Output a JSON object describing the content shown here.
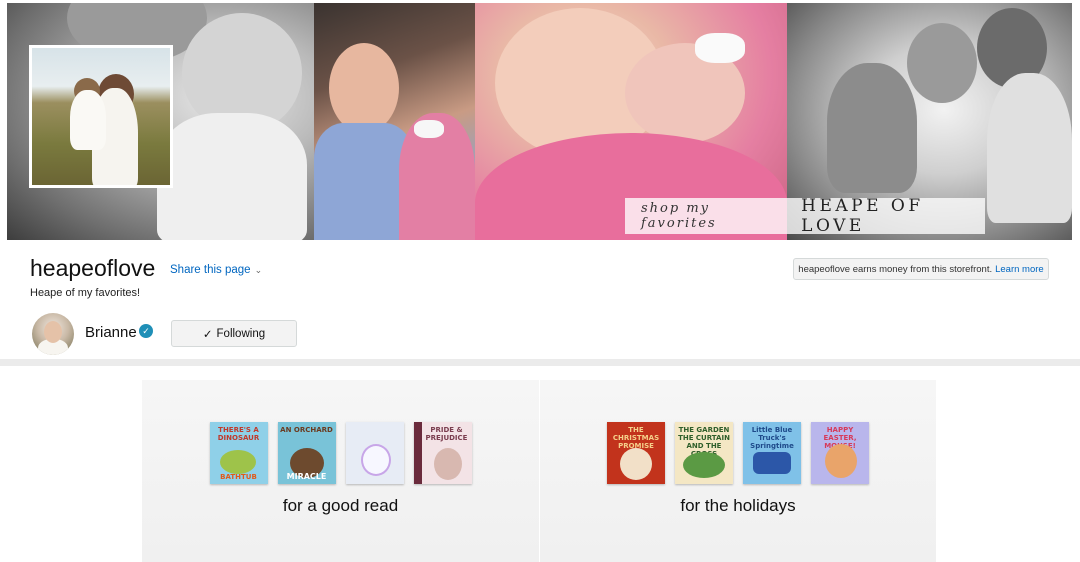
{
  "banner": {
    "tagline_small": "shop my favorites",
    "tagline_big": "HEAPE OF LOVE"
  },
  "store": {
    "title": "heapeoflove",
    "share_label": "Share this page",
    "subtitle": "Heape of my favorites!",
    "earn_text": "heapeoflove earns money from this storefront.",
    "earn_link": "Learn more"
  },
  "owner": {
    "name": "Brianne",
    "follow_label": "Following"
  },
  "collections": [
    {
      "label": "for a good read",
      "books": [
        {
          "title": "THERE'S A DINOSAUR",
          "sub": "BATHTUB"
        },
        {
          "title": "AN ORCHARD",
          "sub": "MIRACLE"
        },
        {
          "title": "",
          "sub": ""
        },
        {
          "title": "PRIDE & PREJUDICE",
          "sub": ""
        }
      ]
    },
    {
      "label": "for the holidays",
      "books": [
        {
          "title": "THE CHRISTMAS PROMISE",
          "sub": ""
        },
        {
          "title": "THE GARDEN THE CURTAIN AND THE CROSS",
          "sub": ""
        },
        {
          "title": "Little Blue Truck's Springtime",
          "sub": ""
        },
        {
          "title": "HAPPY EASTER, MOUSE!",
          "sub": ""
        }
      ]
    }
  ],
  "icons": {
    "verified": "verified-badge-icon",
    "share_caret": "chevron-down-icon",
    "follow_check": "checkmark-icon"
  },
  "colors": {
    "link": "#0066c0",
    "verified": "#1f8fb7",
    "divider": "#ebebeb"
  }
}
